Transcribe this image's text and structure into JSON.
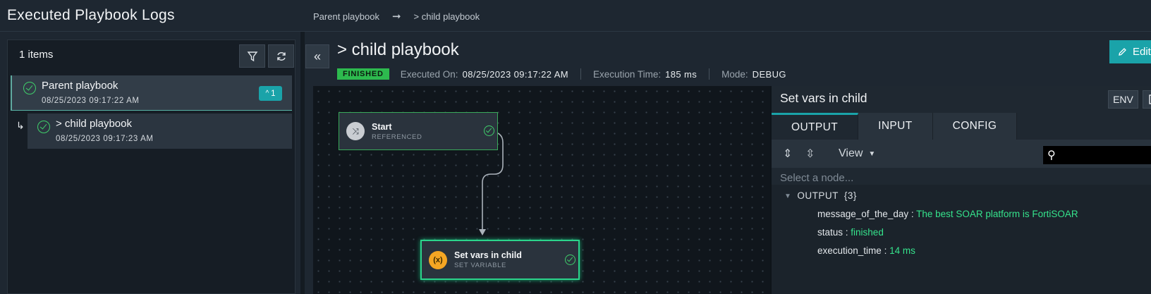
{
  "header": {
    "app_title": "Executed Playbook Logs",
    "breadcrumb": {
      "parent": "Parent playbook",
      "arrow": "➞",
      "current": "> child playbook"
    }
  },
  "left_panel": {
    "items_count": "1 items",
    "filter_icon": "filter-icon",
    "refresh_icon": "refresh-icon",
    "logs": [
      {
        "title": "Parent playbook",
        "date": "08/25/2023 09:17:22 AM",
        "status": "success",
        "badge": "1"
      },
      {
        "title": "> child playbook",
        "date": "08/25/2023 09:17:23 AM",
        "status": "success"
      }
    ]
  },
  "main": {
    "collapse_label": "«",
    "playbook_title": "> child playbook",
    "status": "FINISHED",
    "executed_on_label": "Executed On:",
    "executed_on": "08/25/2023 09:17:22 AM",
    "execution_time_label": "Execution Time:",
    "execution_time": "185 ms",
    "mode_label": "Mode:",
    "mode": "DEBUG",
    "edit_label": "Edit"
  },
  "canvas": {
    "nodes": [
      {
        "name": "Start",
        "type": "REFERENCED",
        "icon": "start-icon",
        "status": "success"
      },
      {
        "name": "Set vars in child",
        "type": "SET VARIABLE",
        "icon_text": "(x)",
        "status": "success"
      }
    ]
  },
  "detail": {
    "title": "Set vars in child",
    "env_label": "ENV",
    "tabs": [
      "OUTPUT",
      "INPUT",
      "CONFIG"
    ],
    "active_tab": "OUTPUT",
    "view_label": "View",
    "select_placeholder": "Select a node...",
    "tree_root": "OUTPUT",
    "tree_count": "{3}",
    "output": [
      {
        "key": "message_of_the_day",
        "value": "The best SOAR platform is FortiSOAR"
      },
      {
        "key": "status",
        "value": "finished"
      },
      {
        "key": "execution_time",
        "value": "14 ms"
      }
    ]
  },
  "colors": {
    "accent": "#1aa3a9",
    "success": "#2dba4e",
    "value_green": "#35e38c",
    "set_variable": "#f5a623"
  }
}
